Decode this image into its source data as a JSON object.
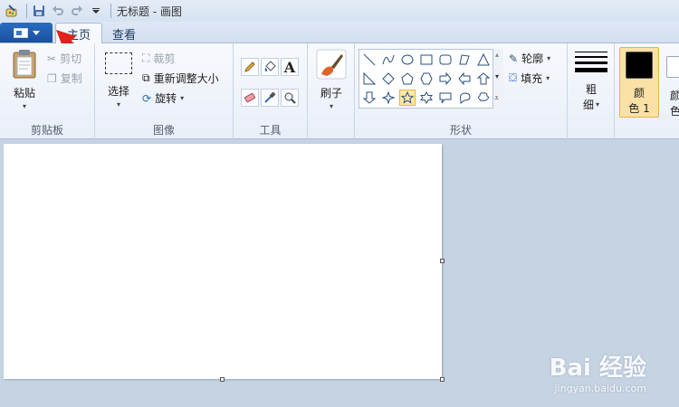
{
  "window": {
    "title": "无标题 - 画图"
  },
  "tabs": {
    "home": "主页",
    "view": "查看"
  },
  "clipboard": {
    "paste": "粘贴",
    "cut": "剪切",
    "copy": "复制",
    "group": "剪贴板"
  },
  "image": {
    "select": "选择",
    "crop": "裁剪",
    "resize": "重新调整大小",
    "rotate": "旋转",
    "group": "图像"
  },
  "tools": {
    "group": "工具",
    "text_glyph": "A"
  },
  "brushes": {
    "label": "刷子"
  },
  "shapes": {
    "outline": "轮廓",
    "fill": "填充",
    "group": "形状"
  },
  "size": {
    "label1": "粗",
    "label2": "细"
  },
  "colors": {
    "color1_line1": "颜",
    "color1_line2": "色 1",
    "color2_line1": "颜",
    "color2_line2": "色",
    "color1": "#000000",
    "color2": "#ffffff"
  },
  "watermark": {
    "logo": "Bai 经验",
    "url": "jingyan.baidu.com"
  }
}
